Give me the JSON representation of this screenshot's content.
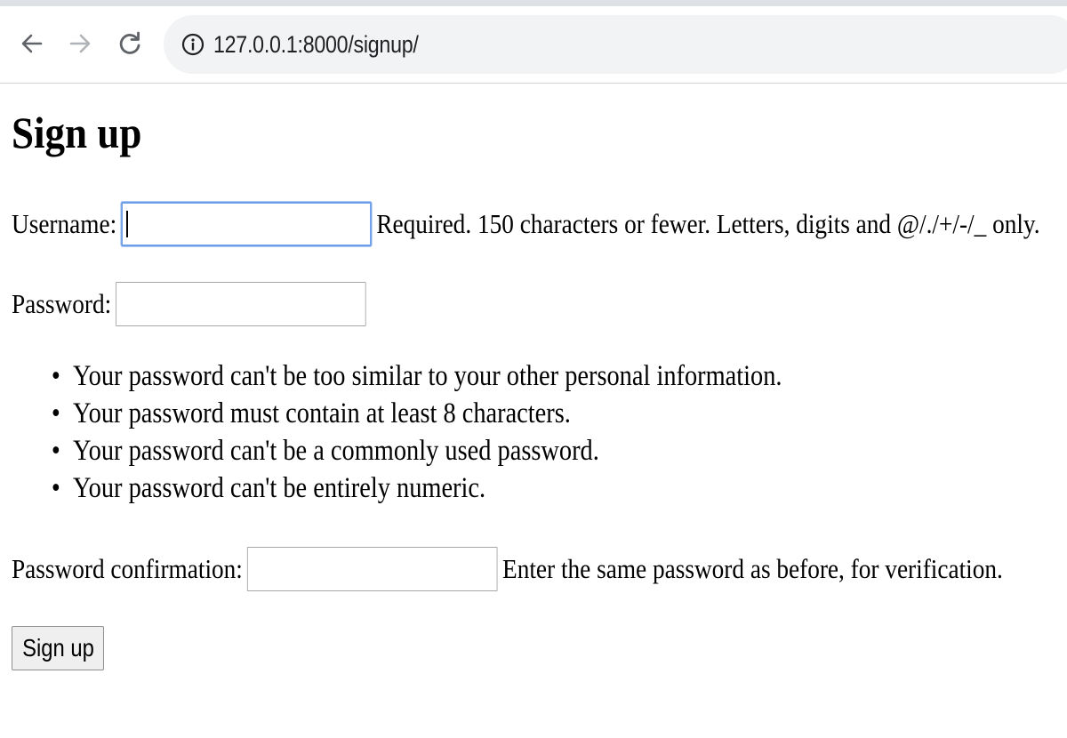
{
  "browser": {
    "url": "127.0.0.1:8000/signup/",
    "icons": {
      "back": "arrow-left-icon",
      "forward": "arrow-right-icon",
      "reload": "reload-icon",
      "site_info": "info-icon"
    }
  },
  "page": {
    "title": "Sign up",
    "username": {
      "label": "Username:",
      "value": "",
      "help": "Required. 150 characters or fewer. Letters, digits and @/./+/-/_ only."
    },
    "password": {
      "label": "Password:",
      "value": "",
      "rules": [
        "Your password can't be too similar to your other personal information.",
        "Your password must contain at least 8 characters.",
        "Your password can't be a commonly used password.",
        "Your password can't be entirely numeric."
      ]
    },
    "password_confirmation": {
      "label": "Password confirmation:",
      "value": "",
      "help": "Enter the same password as before, for verification."
    },
    "submit_label": "Sign up"
  },
  "colors": {
    "focus_border": "#6f9fe8",
    "omnibox_bg": "#f1f3f4",
    "tab_strip_bg": "#dee1e6"
  }
}
